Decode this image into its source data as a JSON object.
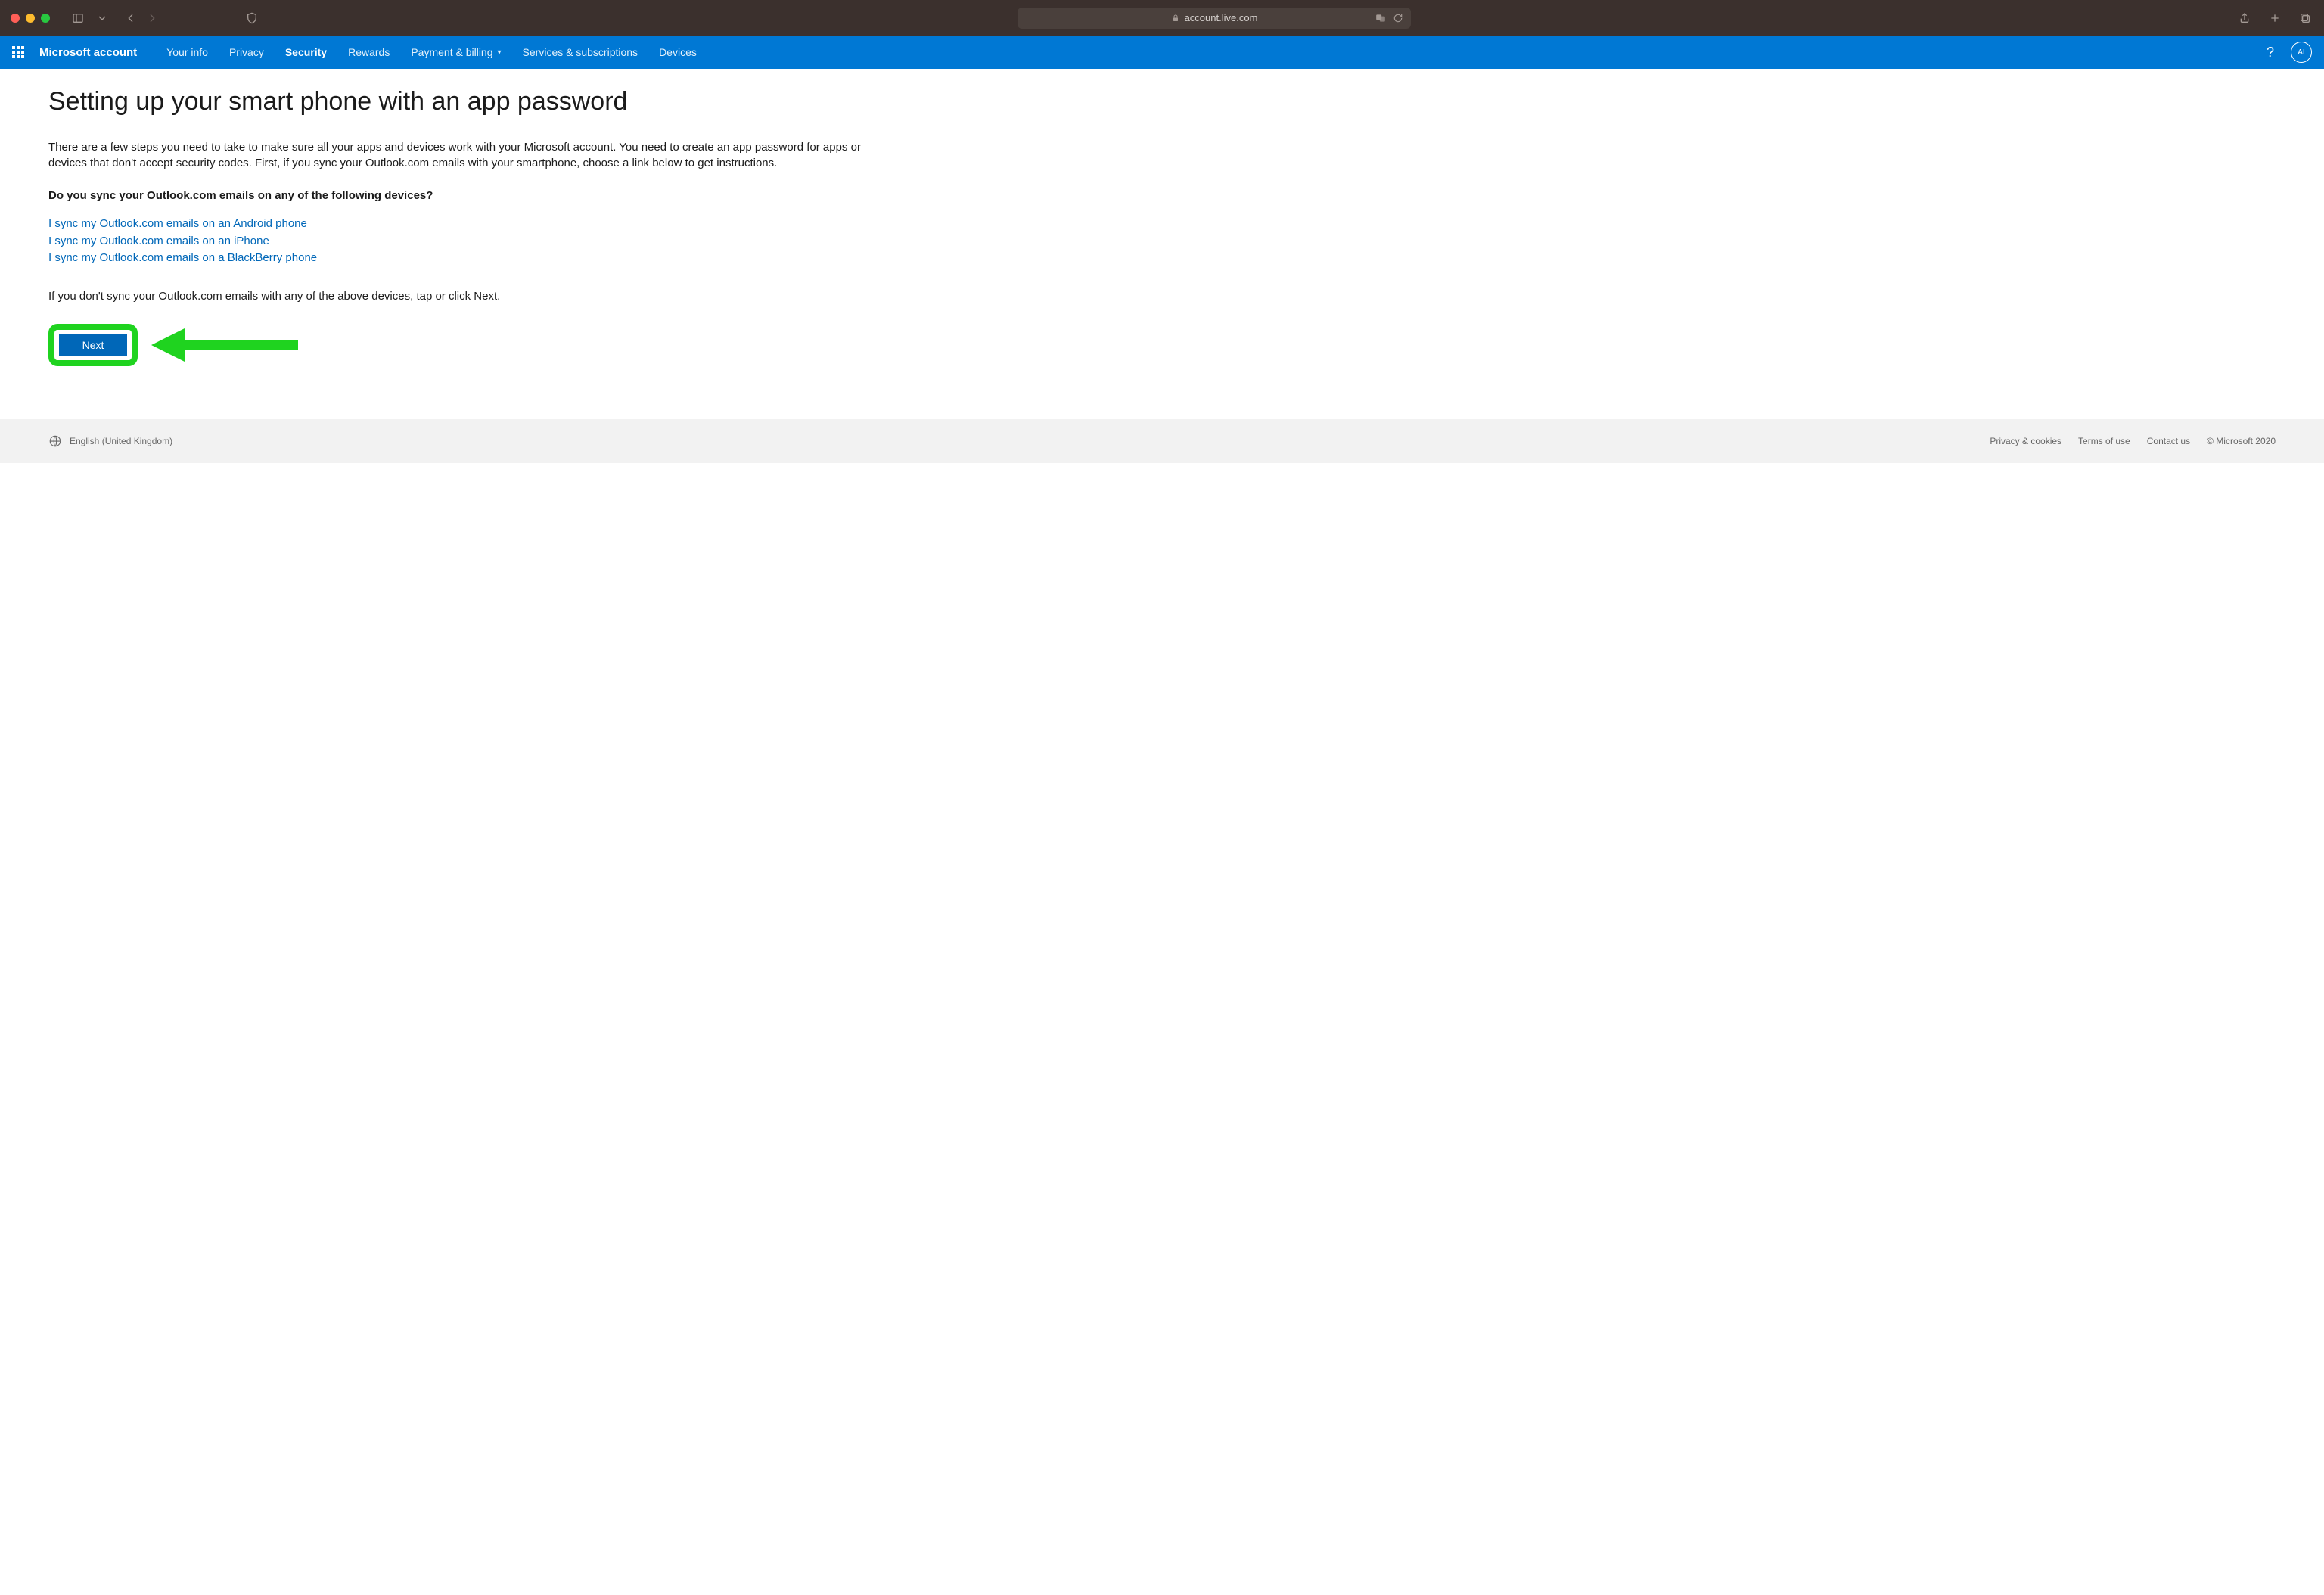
{
  "browser": {
    "url": "account.live.com"
  },
  "nav": {
    "brand": "Microsoft account",
    "tabs": [
      {
        "label": "Your info",
        "active": false
      },
      {
        "label": "Privacy",
        "active": false
      },
      {
        "label": "Security",
        "active": true
      },
      {
        "label": "Rewards",
        "active": false
      },
      {
        "label": "Payment & billing",
        "active": false,
        "dropdown": true
      },
      {
        "label": "Services & subscriptions",
        "active": false
      },
      {
        "label": "Devices",
        "active": false
      }
    ],
    "avatar_initials": "AI"
  },
  "page": {
    "title": "Setting up your smart phone with an app password",
    "intro": "There are a few steps you need to take to make sure all your apps and devices work with your Microsoft account. You need to create an app password for apps or devices that don't accept security codes. First, if you sync your Outlook.com emails with your smartphone, choose a link below to get instructions.",
    "question": "Do you sync your Outlook.com emails on any of the following devices?",
    "links": [
      "I sync my Outlook.com emails on an Android phone",
      "I sync my Outlook.com emails on an iPhone",
      "I sync my Outlook.com emails on a BlackBerry phone"
    ],
    "hint": "If you don't sync your Outlook.com emails with any of the above devices, tap or click Next.",
    "next_label": "Next"
  },
  "footer": {
    "locale": "English (United Kingdom)",
    "links": [
      "Privacy & cookies",
      "Terms of use",
      "Contact us"
    ],
    "copyright": "© Microsoft 2020"
  }
}
